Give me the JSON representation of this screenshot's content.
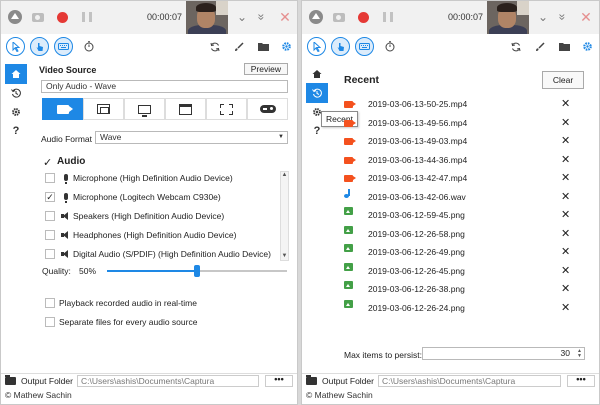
{
  "timer": "00:00:07",
  "video_source": {
    "label": "Video Source",
    "preview_label": "Preview",
    "selected_source": "Only Audio - Wave"
  },
  "audio_format": {
    "label": "Audio Format",
    "value": "Wave"
  },
  "audio": {
    "label": "Audio",
    "enabled_mark": "✓",
    "devices": [
      {
        "name": "Microphone (High Definition Audio Device)",
        "checked": false,
        "kind": "mic"
      },
      {
        "name": "Microphone (Logitech Webcam C930e)",
        "checked": true,
        "kind": "mic"
      },
      {
        "name": "Speakers (High Definition Audio Device)",
        "checked": false,
        "kind": "speaker"
      },
      {
        "name": "Headphones (High Definition Audio Device)",
        "checked": false,
        "kind": "speaker"
      },
      {
        "name": "Digital Audio (S/PDIF) (High Definition Audio Device)",
        "checked": false,
        "kind": "speaker"
      }
    ],
    "quality_label": "Quality:",
    "quality_value": "50%",
    "quality_fraction": 0.5,
    "playback_label": "Playback recorded audio in real-time",
    "separate_files_label": "Separate files for every audio source"
  },
  "footer": {
    "output_label": "Output Folder",
    "output_path": "C:\\Users\\ashis\\Documents\\Captura",
    "browse_label": "•••",
    "credit": "© Mathew Sachin"
  },
  "recent": {
    "title": "Recent",
    "clear_label": "Clear",
    "tooltip": "Recent",
    "remove_glyph": "✕",
    "items": [
      {
        "name": "2019-03-06-13-50-25.mp4",
        "type": "video"
      },
      {
        "name": "2019-03-06-13-49-56.mp4",
        "type": "video"
      },
      {
        "name": "2019-03-06-13-49-03.mp4",
        "type": "video"
      },
      {
        "name": "2019-03-06-13-44-36.mp4",
        "type": "video"
      },
      {
        "name": "2019-03-06-13-42-47.mp4",
        "type": "video"
      },
      {
        "name": "2019-03-06-13-42-06.wav",
        "type": "audio"
      },
      {
        "name": "2019-03-06-12-59-45.png",
        "type": "image"
      },
      {
        "name": "2019-03-06-12-26-58.png",
        "type": "image"
      },
      {
        "name": "2019-03-06-12-26-49.png",
        "type": "image"
      },
      {
        "name": "2019-03-06-12-26-45.png",
        "type": "image"
      },
      {
        "name": "2019-03-06-12-26-38.png",
        "type": "image"
      },
      {
        "name": "2019-03-06-12-26-24.png",
        "type": "image"
      }
    ],
    "max_items_label": "Max items to persist:",
    "max_items_value": "30"
  },
  "glyphs": {
    "minimize": "⌄",
    "minimize_all": "»",
    "close": "✕",
    "help": "?",
    "spin_up": "▲",
    "spin_down": "▼"
  },
  "colors": {
    "accent": "#1e88e5",
    "record": "#e53935",
    "video_file": "#f4511e",
    "audio_file": "#1e88e5",
    "image_file": "#43a047"
  },
  "icons": {
    "titlebar": [
      "collapse-up-icon",
      "camera-icon",
      "record-icon",
      "pause-icon",
      "minimize-icon",
      "close-icon"
    ],
    "toolbar": [
      "cursor-icon",
      "click-icon",
      "keystrokes-icon",
      "timer-icon",
      "refresh-icon",
      "brush-icon",
      "folder-icon",
      "gear-icon"
    ],
    "sidenav": [
      "home-icon",
      "history-icon",
      "gear-icon",
      "help-icon"
    ],
    "sources": [
      "webcam-icon",
      "window-icon",
      "screen-icon",
      "app-window-icon",
      "region-icon",
      "game-icon"
    ]
  }
}
